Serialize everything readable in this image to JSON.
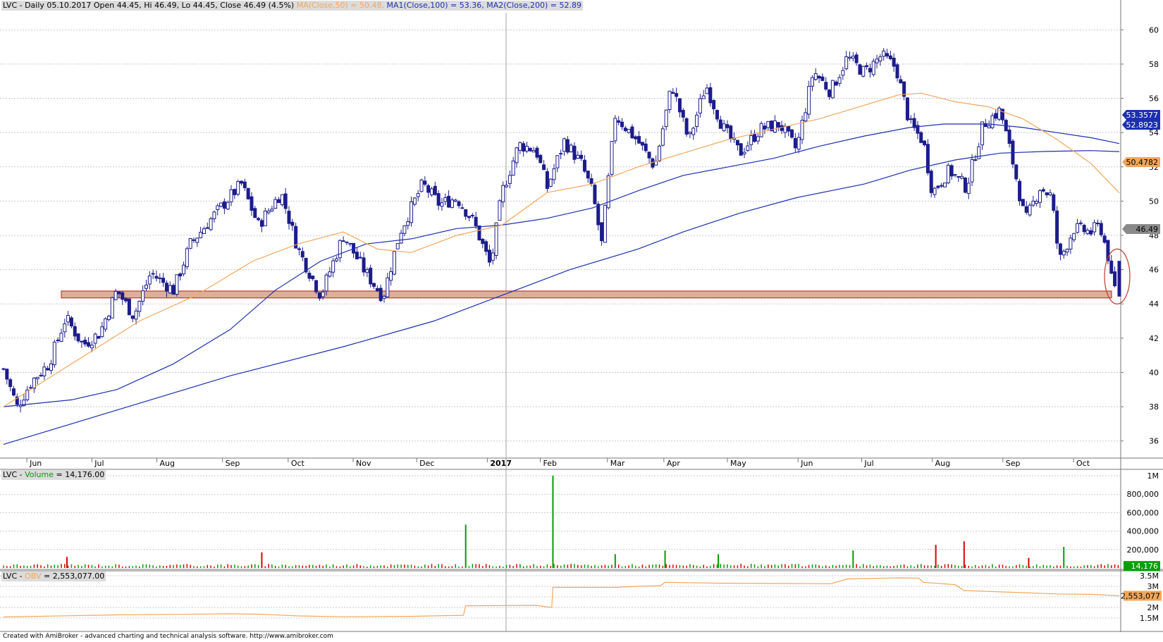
{
  "header": {
    "symbol_prefix": "LVC - Daily 05.10.2017 Open 44.45, Hi 46.49, Lo 44.45, Close 46.49 (4.5%)",
    "ma50_text": "MA(Close,50)",
    "ma50_value": " = 50.48,",
    "ma100_text": " MA1(Close,100) = 53.36,",
    "ma200_text": " MA2(Close,200) = 52.89"
  },
  "volume_header": {
    "prefix": "LVC - ",
    "label": "Volume",
    "value": " = 14,176.00"
  },
  "obv_header": {
    "prefix": "LVC - ",
    "label": "OBV",
    "value": " = 2,553,077.00"
  },
  "footer": "Created with AmiBroker - advanced charting and technical analysis software. http://www.amibroker.com",
  "colors": {
    "candle": "#1c1c8c",
    "ma50": "#f2a65a",
    "ma100": "#1c2fb0",
    "ma200": "#1c2fb0",
    "vol_up": "#00a000",
    "vol_down": "#e00000",
    "obv": "#f2a65a",
    "zone_fill": "#d9b19a",
    "zone_stroke": "#c0392b",
    "grid": "#c8c8c8"
  },
  "chart_data": [
    {
      "type": "candlestick",
      "title": "LVC - Daily",
      "ylim": [
        35,
        61
      ],
      "y_ticks": [
        36,
        38,
        40,
        42,
        44,
        46,
        48,
        50,
        52,
        54,
        56,
        58,
        60
      ],
      "x_labels": [
        "Jun",
        "Jul",
        "Aug",
        "Sep",
        "Oct",
        "Nov",
        "Dec",
        "2017",
        "Feb",
        "Mar",
        "Apr",
        "May",
        "Jun",
        "Jul",
        "Aug",
        "Sep",
        "Oct"
      ],
      "grid": true,
      "last": {
        "open": 44.45,
        "high": 46.49,
        "low": 44.45,
        "close": 46.49
      },
      "close_path": [
        [
          0,
          40.2
        ],
        [
          12,
          38.0
        ],
        [
          25,
          39.5
        ],
        [
          40,
          40.5
        ],
        [
          55,
          43.2
        ],
        [
          70,
          41.6
        ],
        [
          85,
          42.3
        ],
        [
          100,
          44.8
        ],
        [
          115,
          43.3
        ],
        [
          130,
          45.8
        ],
        [
          150,
          44.8
        ],
        [
          165,
          47.5
        ],
        [
          190,
          49.5
        ],
        [
          210,
          51.0
        ],
        [
          225,
          48.6
        ],
        [
          245,
          50.5
        ],
        [
          260,
          47.2
        ],
        [
          280,
          44.5
        ],
        [
          300,
          48.0
        ],
        [
          320,
          45.8
        ],
        [
          335,
          44.4
        ],
        [
          350,
          48.2
        ],
        [
          370,
          51.0
        ],
        [
          385,
          49.8
        ],
        [
          400,
          50.2
        ],
        [
          415,
          48.8
        ],
        [
          430,
          46.2
        ],
        [
          440,
          50.5
        ],
        [
          455,
          53.3
        ],
        [
          470,
          53.0
        ],
        [
          480,
          50.8
        ],
        [
          495,
          53.5
        ],
        [
          510,
          52.2
        ],
        [
          520,
          50.5
        ],
        [
          528,
          47.5
        ],
        [
          540,
          55.0
        ],
        [
          560,
          53.5
        ],
        [
          575,
          52.0
        ],
        [
          590,
          56.8
        ],
        [
          605,
          53.5
        ],
        [
          620,
          56.8
        ],
        [
          635,
          54.3
        ],
        [
          650,
          52.8
        ],
        [
          668,
          54.2
        ],
        [
          685,
          54.5
        ],
        [
          700,
          53.0
        ],
        [
          715,
          57.6
        ],
        [
          730,
          56.4
        ],
        [
          745,
          58.4
        ],
        [
          760,
          57.5
        ],
        [
          775,
          58.5
        ],
        [
          788,
          57.8
        ],
        [
          800,
          54.5
        ],
        [
          812,
          53.5
        ],
        [
          820,
          50.5
        ],
        [
          835,
          51.8
        ],
        [
          850,
          50.8
        ],
        [
          865,
          54.5
        ],
        [
          880,
          55.3
        ],
        [
          892,
          52.0
        ],
        [
          902,
          48.8
        ],
        [
          915,
          50.8
        ],
        [
          925,
          50.3
        ],
        [
          932,
          46.5
        ],
        [
          945,
          48.4
        ],
        [
          960,
          48.2
        ],
        [
          968,
          48.6
        ],
        [
          975,
          46.8
        ],
        [
          980,
          44.5
        ],
        [
          985,
          46.49
        ]
      ],
      "ma50": [
        [
          0,
          38.0
        ],
        [
          60,
          40.5
        ],
        [
          120,
          43.0
        ],
        [
          170,
          44.5
        ],
        [
          220,
          46.5
        ],
        [
          260,
          47.5
        ],
        [
          300,
          48.2
        ],
        [
          330,
          47.2
        ],
        [
          360,
          47.0
        ],
        [
          400,
          48.0
        ],
        [
          440,
          48.6
        ],
        [
          480,
          50.5
        ],
        [
          520,
          51.0
        ],
        [
          560,
          52.0
        ],
        [
          600,
          52.8
        ],
        [
          640,
          53.6
        ],
        [
          680,
          54.2
        ],
        [
          720,
          54.8
        ],
        [
          760,
          55.6
        ],
        [
          790,
          56.2
        ],
        [
          810,
          56.3
        ],
        [
          840,
          55.8
        ],
        [
          870,
          55.5
        ],
        [
          900,
          54.8
        ],
        [
          930,
          53.6
        ],
        [
          960,
          52.2
        ],
        [
          985,
          50.48
        ]
      ],
      "ma100": [
        [
          0,
          38.0
        ],
        [
          60,
          38.4
        ],
        [
          100,
          39.0
        ],
        [
          150,
          40.5
        ],
        [
          200,
          42.5
        ],
        [
          240,
          44.8
        ],
        [
          280,
          46.5
        ],
        [
          320,
          47.5
        ],
        [
          360,
          47.8
        ],
        [
          400,
          48.4
        ],
        [
          440,
          48.6
        ],
        [
          480,
          49.0
        ],
        [
          520,
          49.6
        ],
        [
          560,
          50.6
        ],
        [
          600,
          51.5
        ],
        [
          640,
          52.0
        ],
        [
          680,
          52.5
        ],
        [
          720,
          53.2
        ],
        [
          760,
          53.8
        ],
        [
          800,
          54.3
        ],
        [
          830,
          54.5
        ],
        [
          870,
          54.5
        ],
        [
          900,
          54.3
        ],
        [
          930,
          54.0
        ],
        [
          960,
          53.7
        ],
        [
          985,
          53.36
        ]
      ],
      "ma200": [
        [
          0,
          35.8
        ],
        [
          100,
          37.8
        ],
        [
          200,
          39.8
        ],
        [
          300,
          41.5
        ],
        [
          380,
          43.0
        ],
        [
          420,
          44.0
        ],
        [
          460,
          45.0
        ],
        [
          500,
          46.0
        ],
        [
          560,
          47.2
        ],
        [
          600,
          48.2
        ],
        [
          650,
          49.3
        ],
        [
          700,
          50.2
        ],
        [
          760,
          51.0
        ],
        [
          800,
          51.8
        ],
        [
          840,
          52.4
        ],
        [
          880,
          52.8
        ],
        [
          920,
          52.9
        ],
        [
          960,
          52.95
        ],
        [
          985,
          52.89
        ]
      ],
      "support_zone": [
        44.35,
        44.75
      ],
      "price_tags": [
        "53.3577",
        "52.8923",
        "50.4782",
        "46.49"
      ]
    },
    {
      "type": "bar",
      "title": "Volume",
      "ylim": [
        0,
        1000000
      ],
      "y_ticks": [
        [
          "1M",
          1000000
        ],
        [
          "800,000",
          800000
        ],
        [
          "600,000",
          600000
        ],
        [
          "400,000",
          400000
        ],
        [
          "200,000",
          200000
        ]
      ],
      "last_value": "14,176",
      "spikes": [
        [
          56,
          120000,
          "down"
        ],
        [
          228,
          170000,
          "down"
        ],
        [
          408,
          470000,
          "up"
        ],
        [
          485,
          1000000,
          "up"
        ],
        [
          540,
          150000,
          "up"
        ],
        [
          584,
          190000,
          "up"
        ],
        [
          631,
          150000,
          "up"
        ],
        [
          750,
          190000,
          "up"
        ],
        [
          823,
          250000,
          "down"
        ],
        [
          848,
          290000,
          "down"
        ],
        [
          936,
          230000,
          "up"
        ],
        [
          905,
          110000,
          "down"
        ]
      ]
    },
    {
      "type": "line",
      "title": "OBV",
      "ylim": [
        1300000,
        3700000
      ],
      "y_ticks": [
        [
          "3.5M",
          3500000
        ],
        [
          "3M",
          3000000
        ],
        [
          "2.5M",
          2500000
        ],
        [
          "2M",
          2000000
        ],
        [
          "1.5M",
          1500000
        ]
      ],
      "last_value": "2,553,077",
      "path": [
        [
          0,
          1550000
        ],
        [
          100,
          1650000
        ],
        [
          200,
          1700000
        ],
        [
          228,
          1680000
        ],
        [
          260,
          1600000
        ],
        [
          300,
          1560000
        ],
        [
          360,
          1580000
        ],
        [
          406,
          1630000
        ],
        [
          408,
          2080000
        ],
        [
          470,
          2100000
        ],
        [
          484,
          2000000
        ],
        [
          485,
          2950000
        ],
        [
          540,
          2950000
        ],
        [
          560,
          3000000
        ],
        [
          580,
          3030000
        ],
        [
          584,
          3190000
        ],
        [
          630,
          3150000
        ],
        [
          700,
          3130000
        ],
        [
          730,
          3120000
        ],
        [
          745,
          3350000
        ],
        [
          790,
          3400000
        ],
        [
          808,
          3390000
        ],
        [
          812,
          3190000
        ],
        [
          840,
          3080000
        ],
        [
          848,
          2800000
        ],
        [
          860,
          2780000
        ],
        [
          900,
          2700000
        ],
        [
          930,
          2640000
        ],
        [
          960,
          2620000
        ],
        [
          985,
          2553077
        ]
      ]
    }
  ]
}
